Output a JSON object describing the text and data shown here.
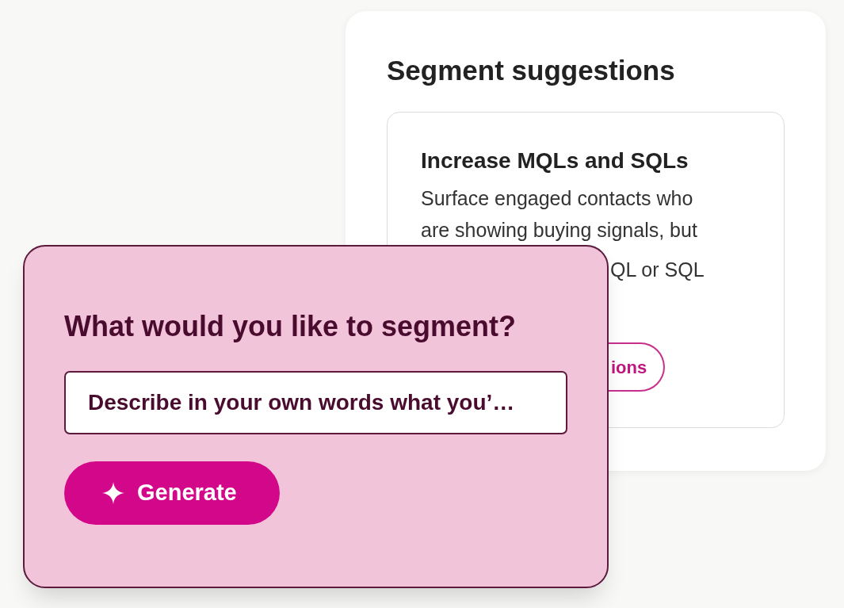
{
  "suggestions_panel": {
    "title": "Segment suggestions",
    "card": {
      "title": "Increase MQLs and SQLs",
      "lines": [
        "Surface engaged contacts who",
        "are showing buying signals, but"
      ],
      "line_3": "QL or SQL",
      "button": "ions"
    }
  },
  "prompt_card": {
    "heading": "What would you like to segment?",
    "input": {
      "placeholder": "Describe in your own words what you’…"
    },
    "button": {
      "label": "Generate"
    }
  }
}
